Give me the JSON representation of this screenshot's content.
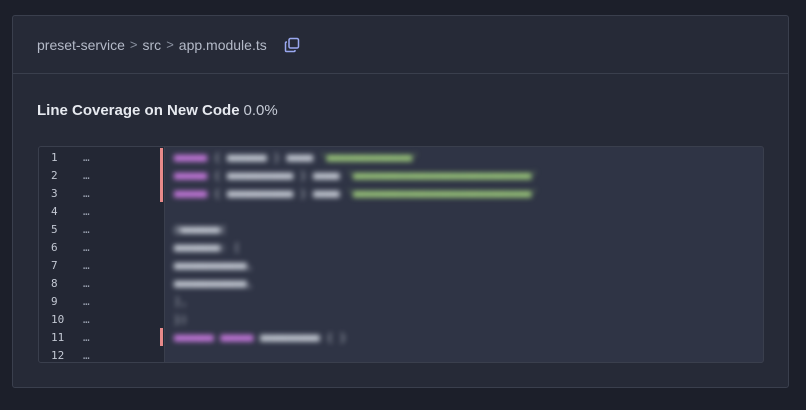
{
  "breadcrumb": {
    "items": [
      "preset-service",
      "src",
      "app.module.ts"
    ],
    "separator": ">"
  },
  "coverage": {
    "label": "Line Coverage on New Code",
    "value": "0.0%"
  },
  "code_viewer": {
    "lines": [
      {
        "number": "1",
        "dots": "…",
        "uncovered": true
      },
      {
        "number": "2",
        "dots": "…",
        "uncovered": true
      },
      {
        "number": "3",
        "dots": "…",
        "uncovered": true
      },
      {
        "number": "4",
        "dots": "…",
        "uncovered": false
      },
      {
        "number": "5",
        "dots": "…",
        "uncovered": false
      },
      {
        "number": "6",
        "dots": "…",
        "uncovered": false
      },
      {
        "number": "7",
        "dots": "…",
        "uncovered": false
      },
      {
        "number": "8",
        "dots": "…",
        "uncovered": false
      },
      {
        "number": "9",
        "dots": "…",
        "uncovered": false
      },
      {
        "number": "10",
        "dots": "…",
        "uncovered": false
      },
      {
        "number": "11",
        "dots": "…",
        "uncovered": true
      },
      {
        "number": "12",
        "dots": "…",
        "uncovered": false
      }
    ]
  },
  "colors": {
    "background": "#1c1f2a",
    "card": "#262a37",
    "uncovered_marker": "#e88a8a",
    "code_bg": "#2f3445"
  },
  "icons": {
    "copy": "copy-icon"
  }
}
